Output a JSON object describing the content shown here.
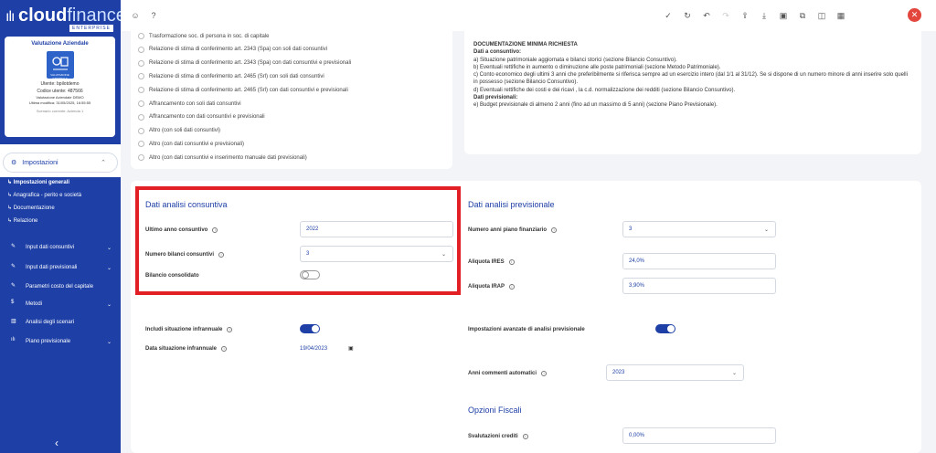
{
  "app": {
    "brand_main": "cloud",
    "brand_sub": "finance",
    "edition": "ENTERPRISE"
  },
  "card": {
    "title": "Valutazione Aziendale",
    "icon_caption": "VALUTAZIONE AZIENDALE",
    "user": "Utente: bpilotdemo",
    "code": "Codice utente: 487566",
    "line1": "Valutazione Aziendale DEMO",
    "line2": "Ultima modifica: 31/05/2025, 16:55:55",
    "scenario": "Scenario corrente: Azienda 1"
  },
  "menu": {
    "impostazioni": "Impostazioni",
    "subs": [
      "Impostazioni generali",
      "Anagrafica - perito e società",
      "Documentazione",
      "Relazione"
    ],
    "items": [
      "Input dati consuntivi",
      "Input dati previsionali",
      "Parametri costo del capitale",
      "Metodi",
      "Analisi degli scenari",
      "Piano previsionale"
    ]
  },
  "radios": [
    "Trasformazione soc. di persona in soc. di capitale",
    "Relazione di stima di conferimento art. 2343 (Spa) con soli dati consuntivi",
    "Relazione di stima di conferimento art. 2343 (Spa) con dati consuntivi e previsionali",
    "Relazione di stima di conferimento art. 2465 (Srl) con soli dati consuntivi",
    "Relazione di stima di conferimento art. 2465 (Srl) con dati consuntivi e previsionali",
    "Affrancamento con soli dati consuntivi",
    "Affrancamento con dati consuntivi e previsionali",
    "Altro (con soli dati consuntivi)",
    "Altro (con dati consuntivi e previsionali)",
    "Altro (con dati consuntivi e inserimento manuale dati previsionali)"
  ],
  "doc": {
    "title": "DOCUMENTAZIONE MINIMA RICHIESTA",
    "consuntivo_h": "Dati a consuntivo:",
    "lines": [
      "a) Situazione patrimoniale aggiornata e bilanci storici (sezione Bilancio Consuntivo).",
      "b) Eventuali rettifiche in aumento o diminuzione alle poste patrimoniali (sezione Metodo Patrimoniale).",
      "c) Conto economico degli ultimi 3 anni che preferibilmente si riferisca sempre ad un esercizio intero (dal 1/1 al 31/12). Se si dispone di un numero minore di anni inserire solo quelli in possesso (sezione Bilancio Consuntivo).",
      "d) Eventuali rettifiche dei costi e dei ricavi , la c.d. normalizzazione dei redditi (sezione Bilancio Consuntivo)."
    ],
    "previsionali_h": "Dati previsionali:",
    "prev_line": "e) Budget previsionale di almeno 2 anni (fino ad un massimo di 5 anni) (sezione Piano Previsionale)."
  },
  "consuntiva": {
    "heading": "Dati analisi consuntiva",
    "ultimo_label": "Ultimo anno consuntivo",
    "ultimo_value": "2022",
    "numero_label": "Numero bilanci consuntivi",
    "numero_value": "3",
    "consolidato_label": "Bilancio consolidato",
    "consolidato_on": false
  },
  "previsionale": {
    "heading": "Dati analisi previsionale",
    "anni_label": "Numero anni piano finanziario",
    "anni_value": "3",
    "ires_label": "Aliquota IRES",
    "ires_value": "24,0%",
    "irap_label": "Aliquota IRAP",
    "irap_value": "3,90%"
  },
  "infrannuale": {
    "includi_label": "Includi situazione infrannuale",
    "includi_on": true,
    "data_label": "Data situazione infrannuale",
    "data_value": "19/04/2023"
  },
  "avanzate": {
    "label": "Impostazioni avanzate di analisi previsionale",
    "on": true,
    "anni_commenti_label": "Anni commenti automatici",
    "anni_commenti_value": "2023"
  },
  "fiscali": {
    "heading": "Opzioni Fiscali",
    "svalutazioni_label": "Svalutazioni crediti",
    "svalutazioni_value": "0,00%"
  },
  "colors": {
    "primary": "#1d3fa6",
    "highlight": "#e21f24",
    "close": "#e2463d"
  }
}
